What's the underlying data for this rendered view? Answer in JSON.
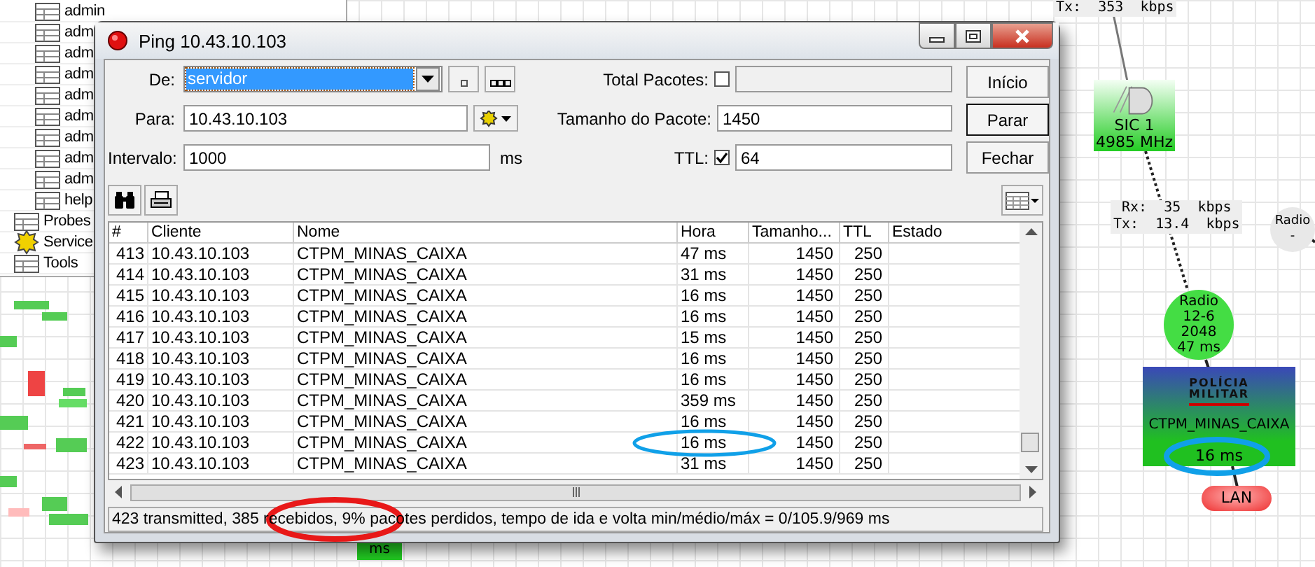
{
  "tree": {
    "sub_items": [
      {
        "label": "admin",
        "kind": "table"
      },
      {
        "label": "adm",
        "kind": "table"
      },
      {
        "label": "adm",
        "kind": "table"
      },
      {
        "label": "adm",
        "kind": "table"
      },
      {
        "label": "adm",
        "kind": "table"
      },
      {
        "label": "adm",
        "kind": "table"
      },
      {
        "label": "adm",
        "kind": "table"
      },
      {
        "label": "adm",
        "kind": "table"
      },
      {
        "label": "adm",
        "kind": "table"
      },
      {
        "label": "help",
        "kind": "table"
      }
    ],
    "items": [
      {
        "label": "Probes",
        "kind": "table"
      },
      {
        "label": "Service",
        "kind": "service"
      },
      {
        "label": "Tools",
        "kind": "table"
      }
    ]
  },
  "dialog": {
    "title": "Ping 10.43.10.103",
    "from": {
      "label": "De:",
      "value": "servidor"
    },
    "to": {
      "label": "Para:",
      "value": "10.43.10.103"
    },
    "interval": {
      "label": "Intervalo:",
      "value": "1000",
      "unit": "ms"
    },
    "total_packets": {
      "label": "Total Pacotes:",
      "checked": false
    },
    "packet_size": {
      "label": "Tamanho do Pacote:",
      "value": "1450"
    },
    "ttl": {
      "label": "TTL:",
      "checked": true,
      "value": "64"
    },
    "buttons": [
      {
        "label": "Início",
        "default": false
      },
      {
        "label": "Parar",
        "default": true
      },
      {
        "label": "Fechar",
        "default": false
      }
    ],
    "table": {
      "columns": [
        "#",
        "Cliente",
        "Nome",
        "Hora",
        "Tamanho...",
        "TTL",
        "Estado"
      ],
      "rows": [
        [
          "413",
          "10.43.10.103",
          "CTPM_MINAS_CAIXA",
          "47 ms",
          "1450",
          "250"
        ],
        [
          "414",
          "10.43.10.103",
          "CTPM_MINAS_CAIXA",
          "31 ms",
          "1450",
          "250"
        ],
        [
          "415",
          "10.43.10.103",
          "CTPM_MINAS_CAIXA",
          "16 ms",
          "1450",
          "250"
        ],
        [
          "416",
          "10.43.10.103",
          "CTPM_MINAS_CAIXA",
          "16 ms",
          "1450",
          "250"
        ],
        [
          "417",
          "10.43.10.103",
          "CTPM_MINAS_CAIXA",
          "15 ms",
          "1450",
          "250"
        ],
        [
          "418",
          "10.43.10.103",
          "CTPM_MINAS_CAIXA",
          "16 ms",
          "1450",
          "250"
        ],
        [
          "419",
          "10.43.10.103",
          "CTPM_MINAS_CAIXA",
          "16 ms",
          "1450",
          "250"
        ],
        [
          "420",
          "10.43.10.103",
          "CTPM_MINAS_CAIXA",
          "359 ms",
          "1450",
          "250"
        ],
        [
          "421",
          "10.43.10.103",
          "CTPM_MINAS_CAIXA",
          "16 ms",
          "1450",
          "250"
        ],
        [
          "422",
          "10.43.10.103",
          "CTPM_MINAS_CAIXA",
          "16 ms",
          "1450",
          "250"
        ],
        [
          "423",
          "10.43.10.103",
          "CTPM_MINAS_CAIXA",
          "31 ms",
          "1450",
          "250"
        ]
      ]
    },
    "status": "423 transmitted, 385 recebidos, 9% pacotes perdidos, tempo de ida e volta min/médio/máx = 0/105.9/969 ms"
  },
  "map": {
    "link_labels": [
      {
        "lines": [
          "Tx:  353  kbps"
        ]
      },
      {
        "lines": [
          "Rx:  35  kbps",
          "Tx:  13.4  kbps"
        ]
      }
    ],
    "nodes": [
      {
        "kind": "device",
        "lines": [
          "SIC 1",
          "4985 MHz"
        ]
      },
      {
        "kind": "radio",
        "color": "#44dd44",
        "lines": [
          "Radio",
          "12-6",
          "2048",
          "47 ms"
        ]
      },
      {
        "kind": "radio",
        "color": "#e8e8e8",
        "lines": [
          "Radio",
          "-"
        ]
      },
      {
        "kind": "host",
        "logo": [
          "POLÍCIA",
          "MILITAR"
        ],
        "lines": [
          "CTPM_MINAS_CAIXA",
          "16 ms"
        ]
      },
      {
        "kind": "cloud",
        "lines": [
          "LAN"
        ]
      },
      {
        "kind": "small",
        "lines": [
          "ms"
        ]
      }
    ]
  }
}
